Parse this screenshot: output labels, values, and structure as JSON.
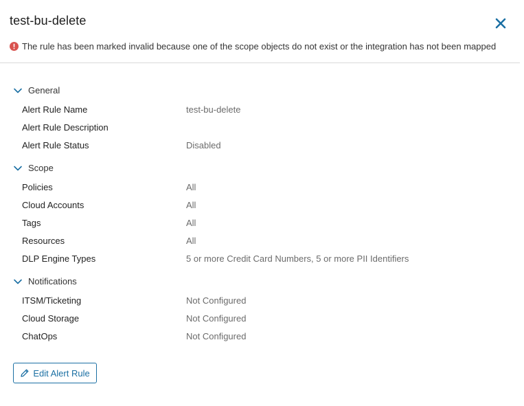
{
  "header": {
    "title": "test-bu-delete",
    "close_icon": "close-icon"
  },
  "alert": {
    "icon": "error-icon",
    "message": "The rule has been marked invalid because one of the scope objects do not exist or the integration has not been mapped",
    "color": "#d9534f"
  },
  "sections": [
    {
      "title": "General",
      "rows": [
        {
          "label": "Alert Rule Name",
          "value": "test-bu-delete"
        },
        {
          "label": "Alert Rule Description",
          "value": ""
        },
        {
          "label": "Alert Rule Status",
          "value": "Disabled"
        }
      ]
    },
    {
      "title": "Scope",
      "rows": [
        {
          "label": "Policies",
          "value": "All"
        },
        {
          "label": "Cloud Accounts",
          "value": "All"
        },
        {
          "label": "Tags",
          "value": "All"
        },
        {
          "label": "Resources",
          "value": "All"
        },
        {
          "label": "DLP Engine Types",
          "value": "5 or more Credit Card Numbers, 5 or more PII Identifiers"
        }
      ]
    },
    {
      "title": "Notifications",
      "rows": [
        {
          "label": "ITSM/Ticketing",
          "value": "Not Configured"
        },
        {
          "label": "Cloud Storage",
          "value": "Not Configured"
        },
        {
          "label": "ChatOps",
          "value": "Not Configured"
        }
      ]
    }
  ],
  "actions": {
    "edit_label": "Edit Alert Rule",
    "edit_icon": "pencil-icon"
  },
  "colors": {
    "accent": "#1a6fa3",
    "value_text": "#6b6b6b"
  }
}
